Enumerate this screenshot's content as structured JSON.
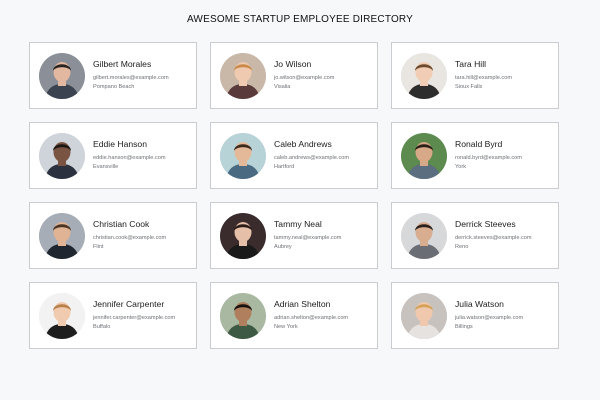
{
  "directory": {
    "title": "AWESOME STARTUP EMPLOYEE DIRECTORY",
    "employees": [
      {
        "name": "Gilbert Morales",
        "email": "gilbert.morales@example.com",
        "city": "Pompano Beach",
        "avatar": {
          "bg": "#8a8f98",
          "hair": "#2a2420",
          "skin": "#e2b8a0",
          "shirt": "#3b4350"
        }
      },
      {
        "name": "Jo Wilson",
        "email": "jo.wilson@example.com",
        "city": "Visalia",
        "avatar": {
          "bg": "#c9b8a8",
          "hair": "#c98a4a",
          "skin": "#efc9b0",
          "shirt": "#5a3a3a"
        }
      },
      {
        "name": "Tara Hill",
        "email": "tara.hill@example.com",
        "city": "Sioux Falls",
        "avatar": {
          "bg": "#e9e6e1",
          "hair": "#6b4a2e",
          "skin": "#f0cdb4",
          "shirt": "#2d2d2d"
        }
      },
      {
        "name": "Eddie Hanson",
        "email": "eddie.hanson@example.com",
        "city": "Evansville",
        "avatar": {
          "bg": "#cfd4da",
          "hair": "#1c1714",
          "skin": "#7a5442",
          "shirt": "#2c3140"
        }
      },
      {
        "name": "Caleb Andrews",
        "email": "caleb.andrews@example.com",
        "city": "Hartford",
        "avatar": {
          "bg": "#b7d3d8",
          "hair": "#3a2a1e",
          "skin": "#e3b99a",
          "shirt": "#4a6a82"
        }
      },
      {
        "name": "Ronald Byrd",
        "email": "ronald.byrd@example.com",
        "city": "York",
        "avatar": {
          "bg": "#5d8a4e",
          "hair": "#2a2018",
          "skin": "#d8a988",
          "shirt": "#5b6e80"
        }
      },
      {
        "name": "Christian Cook",
        "email": "christian.cook@example.com",
        "city": "Flint",
        "avatar": {
          "bg": "#a7adb6",
          "hair": "#4a3424",
          "skin": "#e0b394",
          "shirt": "#1f2630"
        }
      },
      {
        "name": "Tammy Neal",
        "email": "tammy.neal@example.com",
        "city": "Aubrey",
        "avatar": {
          "bg": "#3a2c2c",
          "hair": "#2a1a16",
          "skin": "#e6bfa8",
          "shirt": "#1a1a1a"
        }
      },
      {
        "name": "Derrick Steeves",
        "email": "derrick.steeves@example.com",
        "city": "Reno",
        "avatar": {
          "bg": "#d7d8da",
          "hair": "#2a221e",
          "skin": "#d8ad90",
          "shirt": "#6a6e74"
        }
      },
      {
        "name": "Jennifer Carpenter",
        "email": "jennifer.carpenter@example.com",
        "city": "Buffalo",
        "avatar": {
          "bg": "#f2f2f2",
          "hair": "#b8804a",
          "skin": "#f0cbb0",
          "shirt": "#1d1d1d"
        }
      },
      {
        "name": "Adrian Shelton",
        "email": "adrian.shelton@example.com",
        "city": "New York",
        "avatar": {
          "bg": "#a9b8a0",
          "hair": "#17120f",
          "skin": "#b07f5e",
          "shirt": "#3d5a45"
        }
      },
      {
        "name": "Julia Watson",
        "email": "julia.watson@example.com",
        "city": "Billings",
        "avatar": {
          "bg": "#c8c2be",
          "hair": "#d6a25a",
          "skin": "#f0c8ae",
          "shirt": "#e6e2e0"
        }
      }
    ]
  }
}
